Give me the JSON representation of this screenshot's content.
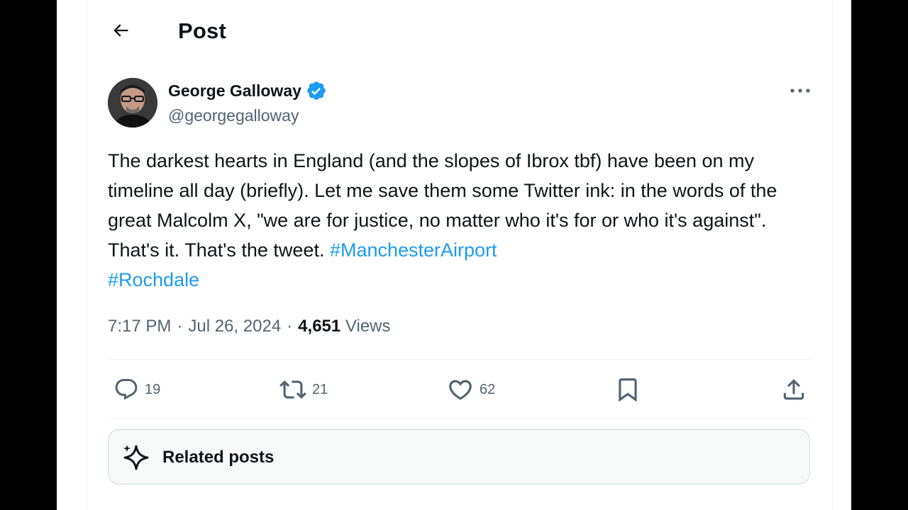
{
  "header": {
    "title": "Post"
  },
  "author": {
    "display_name": "George Galloway",
    "handle": "@georgegalloway",
    "verified": true
  },
  "tweet": {
    "text_parts": [
      "The darkest hearts in England (and the slopes of Ibrox tbf) have been on my timeline all day (briefly). Let me save them some Twitter ink: in the words of the great Malcolm X, \"we are for justice, no matter who it's for or who it's against\". That's it. That's the tweet. "
    ],
    "hashtags": [
      "#ManchesterAirport",
      "#Rochdale"
    ]
  },
  "meta": {
    "time": "7:17 PM",
    "date": "Jul 26, 2024",
    "separator": "·",
    "views_count": "4,651",
    "views_label": "Views"
  },
  "actions": {
    "replies": "19",
    "reposts": "21",
    "likes": "62"
  },
  "related": {
    "label": "Related posts"
  },
  "colors": {
    "accent": "#1d9bf0",
    "text": "#0f1419",
    "secondary": "#536471",
    "border": "#eff3f4"
  },
  "icons": [
    "back-arrow-icon",
    "verified-badge-icon",
    "more-icon",
    "reply-icon",
    "repost-icon",
    "like-icon",
    "bookmark-icon",
    "share-icon",
    "sparkle-icon"
  ]
}
